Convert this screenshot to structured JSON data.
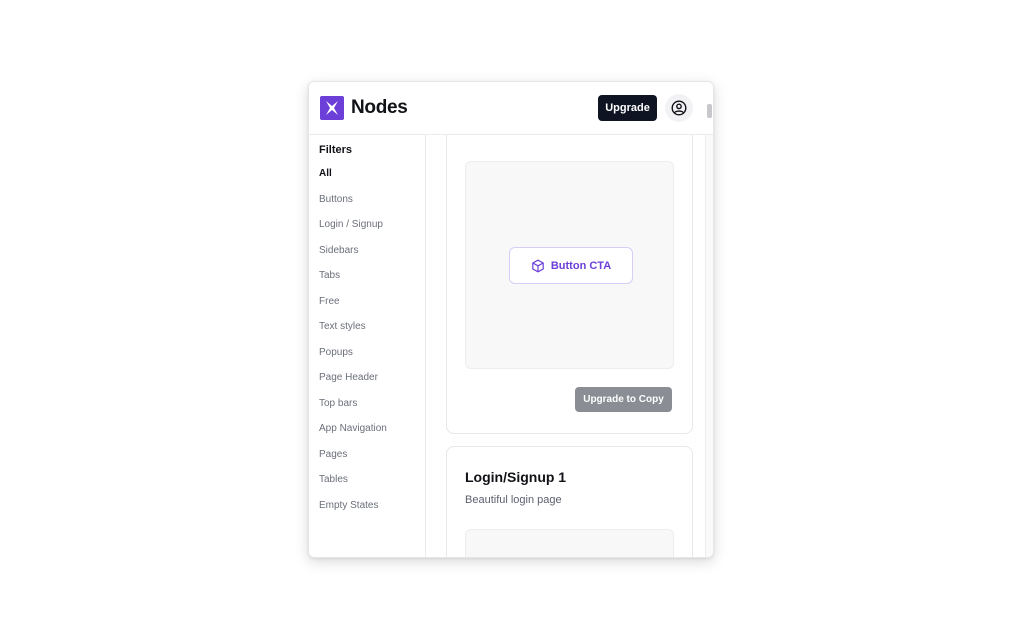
{
  "header": {
    "brand": "Nodes",
    "upgrade_label": "Upgrade",
    "logo_icon": "nodes-logo-icon",
    "profile_icon": "user-circle-icon"
  },
  "sidebar": {
    "title": "Filters",
    "items": [
      {
        "label": "All",
        "active": true
      },
      {
        "label": "Buttons"
      },
      {
        "label": "Login / Signup"
      },
      {
        "label": "Sidebars"
      },
      {
        "label": "Tabs"
      },
      {
        "label": "Free"
      },
      {
        "label": "Text styles"
      },
      {
        "label": "Popups"
      },
      {
        "label": "Page Header"
      },
      {
        "label": "Top bars"
      },
      {
        "label": "App Navigation"
      },
      {
        "label": "Pages"
      },
      {
        "label": "Tables"
      },
      {
        "label": "Empty States"
      }
    ]
  },
  "main": {
    "cards": [
      {
        "preview_button_label": "Button CTA",
        "preview_button_icon": "cube-icon",
        "copy_label": "Upgrade to Copy"
      },
      {
        "title": "Login/Signup 1",
        "subtitle": "Beautiful login page"
      }
    ]
  },
  "colors": {
    "accent": "#6b3fd8",
    "dark_button": "#0f1422",
    "disabled_button": "#8a8d94"
  }
}
